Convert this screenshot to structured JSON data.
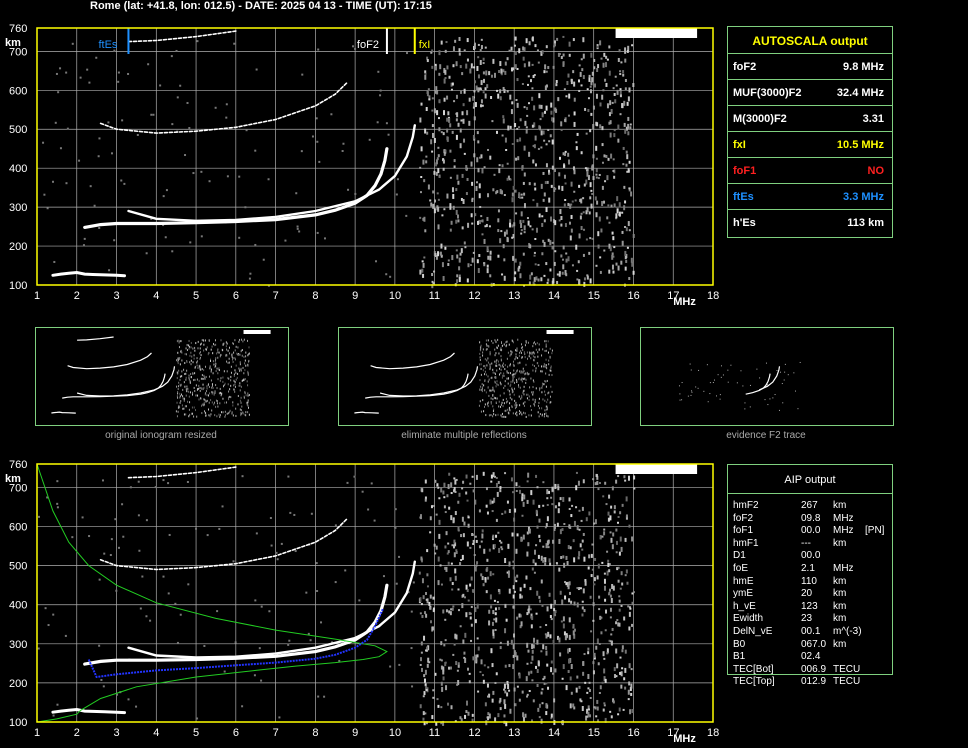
{
  "header": {
    "title": "Rome (lat: +41.8, lon: 012.5) - DATE: 2025 04 13 - TIME (UT): 17:15"
  },
  "colors": {
    "grid": "#b0b0b0",
    "axis": "#ffff00",
    "panel_border": "#7fd07f",
    "foF2_marker": "#ffffff",
    "fxI_marker": "#ffff00",
    "ftEs_marker": "#1e90ff",
    "foF1_color": "#ff0000",
    "ftEs_color": "#1e90ff",
    "profile_color": "#22cc22",
    "trace_fit_color": "#2233ff"
  },
  "autoscala": {
    "title": "AUTOSCALA output",
    "rows": [
      {
        "key": "foF2",
        "value": "9.8 MHz",
        "color": "#ffffff"
      },
      {
        "key": "MUF(3000)F2",
        "value": "32.4 MHz",
        "color": "#ffffff"
      },
      {
        "key": "M(3000)F2",
        "value": "3.31",
        "color": "#ffffff"
      },
      {
        "key": "fxI",
        "value": "10.5 MHz",
        "color": "#ffff00"
      },
      {
        "key": "foF1",
        "value": "NO",
        "color": "#ff2020"
      },
      {
        "key": "ftEs",
        "value": "3.3 MHz",
        "color": "#1e90ff"
      },
      {
        "key": "h'Es",
        "value": "113    km",
        "color": "#ffffff"
      }
    ]
  },
  "aip": {
    "title": "AIP output",
    "rows": [
      {
        "k": "hmF2",
        "v": "267",
        "u": "km",
        "x": ""
      },
      {
        "k": "foF2",
        "v": "09.8",
        "u": "MHz",
        "x": ""
      },
      {
        "k": "foF1",
        "v": "00.0",
        "u": "MHz",
        "x": "[PN]"
      },
      {
        "k": "hmF1",
        "v": "---",
        "u": "km",
        "x": ""
      },
      {
        "k": "D1",
        "v": "00.0",
        "u": "",
        "x": ""
      },
      {
        "k": "foE",
        "v": "2.1",
        "u": "MHz",
        "x": ""
      },
      {
        "k": "hmE",
        "v": "110",
        "u": "km",
        "x": ""
      },
      {
        "k": "ymE",
        "v": "20",
        "u": "km",
        "x": ""
      },
      {
        "k": "h_vE",
        "v": "123",
        "u": "km",
        "x": ""
      },
      {
        "k": "Ewidth",
        "v": "23",
        "u": "km",
        "x": ""
      },
      {
        "k": "DelN_vE",
        "v": "00.1",
        "u": "m^(-3)",
        "x": ""
      },
      {
        "k": "B0",
        "v": "067.0",
        "u": "km",
        "x": ""
      },
      {
        "k": "B1",
        "v": "02.4",
        "u": "",
        "x": ""
      },
      {
        "k": "TEC[Bot]",
        "v": "006.9",
        "u": "TECU",
        "x": ""
      },
      {
        "k": "TEC[Top]",
        "v": "012.9",
        "u": "TECU",
        "x": ""
      }
    ]
  },
  "thumbnails": [
    {
      "caption": "original ionogram resized"
    },
    {
      "caption": "eliminate multiple reflections"
    },
    {
      "caption": "evidence F2 trace"
    }
  ],
  "chart_data": [
    {
      "type": "scatter",
      "name_key": "top-ionogram",
      "xlabel": "MHz",
      "ylabel": "km",
      "xlim": [
        1,
        18
      ],
      "ylim": [
        100,
        760
      ],
      "xticks": [
        "1",
        "2",
        "3",
        "4",
        "5",
        "6",
        "7",
        "8",
        "9",
        "10",
        "11",
        "12",
        "13",
        "14",
        "15",
        "16",
        "17",
        "18"
      ],
      "yticks": [
        "100",
        "200",
        "300",
        "400",
        "500",
        "600",
        "700",
        "760"
      ],
      "grid": true,
      "markers": [
        {
          "label": "ftEs",
          "freq": 3.3,
          "color": "#1e90ff"
        },
        {
          "label": "foF2",
          "freq": 9.8,
          "color": "#ffffff"
        },
        {
          "label": "fxI",
          "freq": 10.5,
          "color": "#ffff00"
        }
      ],
      "traces": {
        "es": [
          [
            1.4,
            125
          ],
          [
            1.6,
            128
          ],
          [
            1.8,
            130
          ],
          [
            2.0,
            132
          ],
          [
            2.2,
            128
          ],
          [
            2.4,
            127
          ],
          [
            2.7,
            126
          ],
          [
            3.0,
            125
          ],
          [
            3.2,
            124
          ]
        ],
        "f2_o": [
          [
            2.2,
            248
          ],
          [
            2.6,
            255
          ],
          [
            3.0,
            258
          ],
          [
            3.5,
            258
          ],
          [
            4,
            258
          ],
          [
            5,
            260
          ],
          [
            6,
            263
          ],
          [
            7,
            268
          ],
          [
            8,
            280
          ],
          [
            8.5,
            292
          ],
          [
            9,
            310
          ],
          [
            9.3,
            330
          ],
          [
            9.5,
            355
          ],
          [
            9.65,
            385
          ],
          [
            9.75,
            420
          ],
          [
            9.8,
            450
          ]
        ],
        "f2_x": [
          [
            3.3,
            290
          ],
          [
            4,
            270
          ],
          [
            5,
            265
          ],
          [
            6,
            267
          ],
          [
            7,
            275
          ],
          [
            8,
            290
          ],
          [
            9,
            315
          ],
          [
            9.6,
            345
          ],
          [
            10,
            380
          ],
          [
            10.3,
            430
          ],
          [
            10.45,
            480
          ],
          [
            10.5,
            510
          ]
        ],
        "f2_2hop": [
          [
            2.6,
            515
          ],
          [
            3,
            500
          ],
          [
            4,
            490
          ],
          [
            5,
            495
          ],
          [
            6,
            505
          ],
          [
            7,
            525
          ],
          [
            8,
            560
          ],
          [
            8.5,
            590
          ],
          [
            8.8,
            620
          ]
        ],
        "es_2hop": [
          [
            3.3,
            725
          ],
          [
            4,
            728
          ],
          [
            5,
            738
          ],
          [
            6,
            752
          ]
        ]
      }
    },
    {
      "type": "scatter",
      "name_key": "bottom-ionogram",
      "xlabel": "MHz",
      "ylabel": "km",
      "xlim": [
        1,
        18
      ],
      "ylim": [
        100,
        760
      ],
      "xticks": [
        "1",
        "2",
        "3",
        "4",
        "5",
        "6",
        "7",
        "8",
        "9",
        "10",
        "11",
        "12",
        "13",
        "14",
        "15",
        "16",
        "17",
        "18"
      ],
      "yticks": [
        "100",
        "200",
        "300",
        "400",
        "500",
        "600",
        "700",
        "760"
      ],
      "grid": true,
      "profile": [
        [
          1.0,
          100
        ],
        [
          1.5,
          108
        ],
        [
          2.0,
          120
        ],
        [
          2.1,
          130
        ],
        [
          2.6,
          160
        ],
        [
          3.5,
          190
        ],
        [
          5,
          215
        ],
        [
          6.5,
          232
        ],
        [
          7.5,
          243
        ],
        [
          8.5,
          252
        ],
        [
          9.2,
          260
        ],
        [
          9.6,
          267
        ],
        [
          9.8,
          280
        ],
        [
          9.5,
          295
        ],
        [
          8.5,
          312
        ],
        [
          7,
          335
        ],
        [
          5.5,
          365
        ],
        [
          4,
          405
        ],
        [
          3,
          450
        ],
        [
          2.3,
          500
        ],
        [
          1.8,
          560
        ],
        [
          1.4,
          640
        ],
        [
          1.0,
          760
        ]
      ],
      "true_height_fit": [
        [
          2.3,
          260
        ],
        [
          2.5,
          215
        ],
        [
          3,
          222
        ],
        [
          4,
          232
        ],
        [
          5,
          238
        ],
        [
          6,
          245
        ],
        [
          7,
          252
        ],
        [
          8,
          262
        ],
        [
          8.5,
          272
        ],
        [
          9,
          290
        ],
        [
          9.3,
          310
        ],
        [
          9.5,
          345
        ],
        [
          9.7,
          390
        ]
      ]
    }
  ]
}
